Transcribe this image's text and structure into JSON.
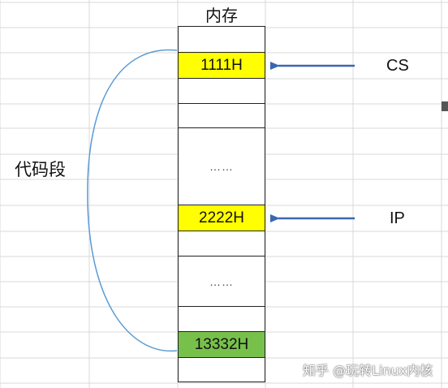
{
  "memory_title": "内存",
  "cells": [
    {
      "text": "",
      "fill": "#ffffff"
    },
    {
      "text": "1111H",
      "fill": "#ffff00"
    },
    {
      "text": "",
      "fill": "#ffffff"
    },
    {
      "text": "",
      "fill": "#ffffff"
    },
    {
      "text": "……",
      "fill": "#ffffff"
    },
    {
      "text": "2222H",
      "fill": "#ffff00"
    },
    {
      "text": "",
      "fill": "#ffffff"
    },
    {
      "text": "……",
      "fill": "#ffffff"
    },
    {
      "text": "",
      "fill": "#ffffff"
    },
    {
      "text": "13332H",
      "fill": "#77c04b"
    },
    {
      "text": "",
      "fill": "#ffffff"
    }
  ],
  "registers": {
    "cs_label": "CS",
    "ip_label": "IP"
  },
  "segment_label": "代码段",
  "watermark": "知乎 @玩转Linux内核",
  "colors": {
    "arrow": "#3a67b1",
    "brace": "#5b9bd5",
    "grid": "#d8d8d8"
  }
}
